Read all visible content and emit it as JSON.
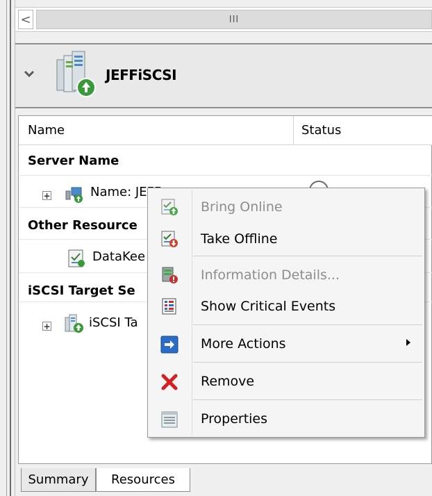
{
  "scrollbar": {
    "left_arrow": "<",
    "thumb_grip": "III"
  },
  "server": {
    "name": "JEFFiSCSI"
  },
  "columns": {
    "name": "Name",
    "status": "Status"
  },
  "groups": [
    {
      "title": "Server Name"
    },
    {
      "title": "Other Resource"
    },
    {
      "title": "iSCSI Target Se"
    }
  ],
  "rows": {
    "server_name_row": "Name: JEFF",
    "other_row": "DataKee",
    "iscsi_row": "iSCSI Ta"
  },
  "context_menu": {
    "items": [
      {
        "label": "Bring Online",
        "enabled": false,
        "icon": "bring-online-icon"
      },
      {
        "label": "Take Offline",
        "enabled": true,
        "icon": "take-offline-icon"
      },
      {
        "label": "Information Details...",
        "enabled": false,
        "icon": "information-details-icon"
      },
      {
        "label": "Show Critical Events",
        "enabled": true,
        "icon": "critical-events-icon"
      },
      {
        "label": "More Actions",
        "enabled": true,
        "icon": "more-actions-icon",
        "has_submenu": true
      },
      {
        "label": "Remove",
        "enabled": true,
        "icon": "remove-icon"
      },
      {
        "label": "Properties",
        "enabled": true,
        "icon": "properties-icon"
      }
    ]
  },
  "tabs": [
    {
      "label": "Summary",
      "active": false
    },
    {
      "label": "Resources",
      "active": true
    }
  ],
  "colors": {
    "remove_red": "#d42020",
    "more_actions_blue": "#2a6cc6",
    "online_green": "#3a9a3a",
    "disabled_text": "#8d8d8d"
  }
}
